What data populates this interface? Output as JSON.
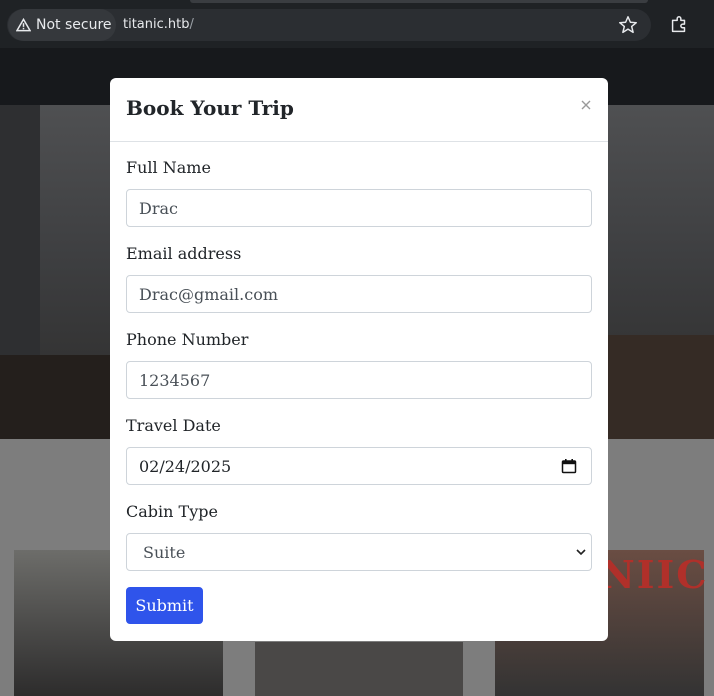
{
  "browser": {
    "security_label": "Not secure",
    "url_host": "titanic.htb",
    "url_path": "/",
    "icons": [
      "warning-icon",
      "star-icon",
      "extensions-icon"
    ]
  },
  "modal": {
    "title": "Book Your Trip",
    "fields": {
      "full_name": {
        "label": "Full Name",
        "value": "Drac"
      },
      "email": {
        "label": "Email address",
        "value": "Drac@gmail.com"
      },
      "phone": {
        "label": "Phone Number",
        "value": "1234567"
      },
      "date": {
        "label": "Travel Date",
        "value": "02/24/2025"
      },
      "cabin": {
        "label": "Cabin Type",
        "selected": "Suite"
      }
    },
    "submit_label": "Submit"
  },
  "background_card_text": "NIIC",
  "colors": {
    "chrome_bg": "#1f2225",
    "submit_bg": "#2f54eb",
    "modal_bg": "#ffffff"
  }
}
